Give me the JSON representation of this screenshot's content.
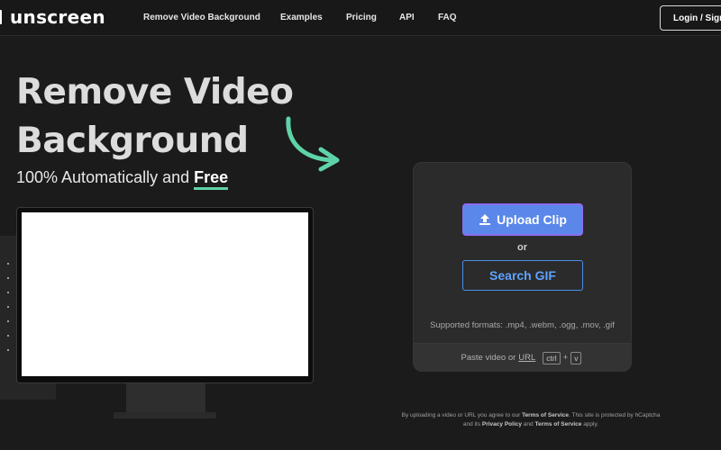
{
  "nav": {
    "logo": "unscreen",
    "links": [
      "Remove Video Background",
      "Examples",
      "Pricing",
      "API",
      "FAQ"
    ],
    "login_label": "Login / Sign up"
  },
  "hero": {
    "title_line1": "Remove Video",
    "title_line2": "Background",
    "subtitle_prefix": "100% Automatically and",
    "subtitle_highlight": "Free"
  },
  "upload": {
    "upload_label": "Upload Clip",
    "or_label": "or",
    "gif_label": "Search GIF",
    "formats": "Supported formats: .mp4, .webm, .ogg, .mov, .gif",
    "paste_prefix": "Paste video or",
    "paste_url": "URL",
    "key_ctrl": "ctrl",
    "key_plus": "+",
    "key_v": "v"
  },
  "disclaimer": {
    "part1": "By uploading a video or URL you agree to our",
    "tos": "Terms of Service",
    "part2": ". This site is protected by hCaptcha and its",
    "privacy": "Privacy Policy",
    "part3": "and",
    "tos2": "Terms of Service",
    "part4": "apply."
  },
  "icons": {
    "upload": "upload-icon",
    "arrow": "curved-arrow-icon"
  },
  "colors": {
    "accent_green": "#5fd3a8",
    "upload_blue": "#5a87e9",
    "gif_blue": "#4a8fe8"
  }
}
